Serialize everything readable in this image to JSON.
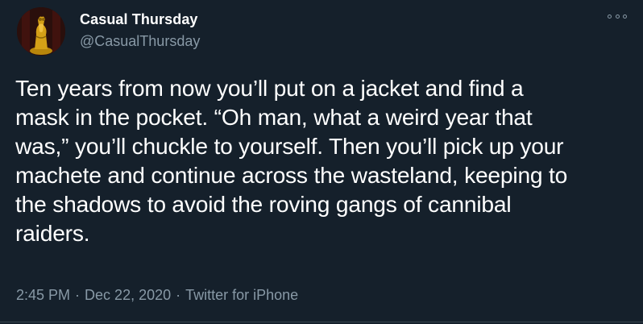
{
  "author": {
    "name": "Casual Thursday",
    "handle": "@CasualThursday",
    "avatar_icon": "golden-figurine-avatar"
  },
  "tweet": {
    "text": "Ten years from now you’ll put on a jacket and find a\nmask in the pocket. “Oh man, what a weird year that\nwas,” you’ll chuckle to yourself. Then you’ll pick up your\nmachete and continue across the wasteland, keeping to\nthe shadows to avoid the roving gangs of cannibal\nraiders.",
    "time": "2:45 PM",
    "date": "Dec 22, 2020",
    "source": "Twitter for iPhone",
    "separator": "·"
  },
  "menu": {
    "icon": "more-options-icon"
  },
  "colors": {
    "background": "#15202b",
    "text": "#ffffff",
    "secondary": "#8899a6",
    "divider": "#38444d"
  }
}
